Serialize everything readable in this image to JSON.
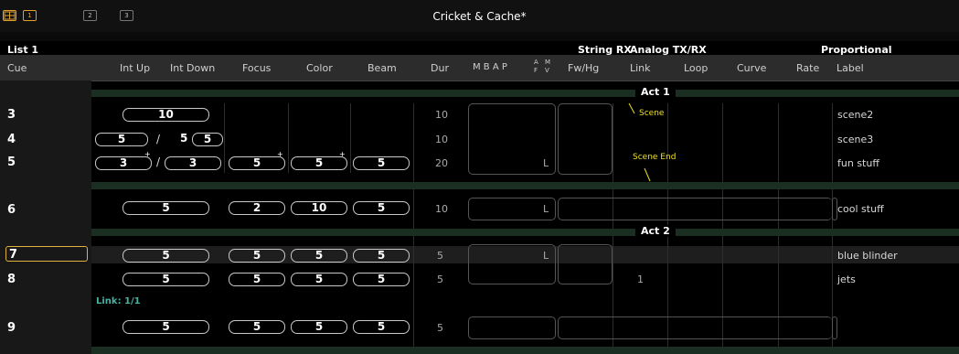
{
  "toolbar": {
    "tab1": "1",
    "tab2": "2",
    "tab3": "3"
  },
  "window": {
    "title": "Cricket & Cache*"
  },
  "sections": {
    "list": "List 1",
    "string_rx": "String RX",
    "analog": "Analog TX/RX",
    "proportional": "Proportional"
  },
  "columns": {
    "cue": "Cue",
    "int_up": "Int Up",
    "int_down": "Int Down",
    "focus": "Focus",
    "color": "Color",
    "beam": "Beam",
    "dur": "Dur",
    "mbap": "M  B  A  P",
    "af_top": "A",
    "af_bot": "F",
    "mv_top": "M",
    "mv_bot": "V",
    "fwhg": "Fw/Hg",
    "link": "Link",
    "loop": "Loop",
    "curve": "Curve",
    "rate": "Rate",
    "label": "Label"
  },
  "parts": {
    "act1": "Act 1",
    "act2": "Act 2"
  },
  "annotations": {
    "scene": "Scene",
    "scene_end": "Scene End"
  },
  "cues": [
    {
      "num": "3",
      "int_up": "10",
      "dur": "10",
      "label": "scene2"
    },
    {
      "num": "4",
      "int_up": "5",
      "int_sep": "/",
      "int_down": "5",
      "int_down_box": "5",
      "dur": "10",
      "label": "scene3"
    },
    {
      "num": "5",
      "int_up": "3",
      "int_sep": "/",
      "int_down": "3",
      "focus": "5",
      "color": "5",
      "beam": "5",
      "dur": "20",
      "flag": "L",
      "label": "fun stuff"
    },
    {
      "num": "6",
      "int_up": "5",
      "focus": "2",
      "color": "10",
      "beam": "5",
      "dur": "10",
      "flag": "L",
      "label": "cool stuff"
    },
    {
      "num": "7",
      "int_up": "5",
      "focus": "5",
      "color": "5",
      "beam": "5",
      "dur": "5",
      "flag": "L",
      "label": "blue blinder"
    },
    {
      "num": "8",
      "int_up": "5",
      "focus": "5",
      "color": "5",
      "beam": "5",
      "dur": "5",
      "link": "1",
      "label": "jets"
    },
    {
      "num": "9",
      "int_up": "5",
      "focus": "5",
      "color": "5",
      "beam": "5",
      "dur": "5"
    }
  ],
  "link_note": "Link: 1/1",
  "colors": {
    "background": "#000000",
    "part_band": "#1a2e22",
    "selected_row": "#1e1e1e",
    "selected_cue_border": "#e0b040",
    "annotation": "#f0e020"
  }
}
